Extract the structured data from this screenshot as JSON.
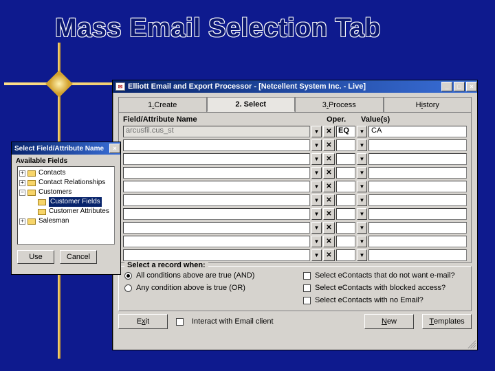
{
  "slide": {
    "title": "Mass Email Selection Tab"
  },
  "app": {
    "title": "Elliott Email and Export Processor - [Netcellent System Inc. - Live]",
    "win_buttons": {
      "min": "_",
      "max": "□",
      "close": "×"
    },
    "tabs": [
      {
        "label_pre": "1",
        "label_u": ".",
        "label_post": " Create"
      },
      {
        "label_pre": "",
        "label_u": "",
        "label_post": "2. Select",
        "active": true
      },
      {
        "label_pre": "3",
        "label_u": ".",
        "label_post": " Process"
      },
      {
        "label_pre": "H",
        "label_u": "i",
        "label_post": "story"
      }
    ],
    "headers": {
      "name": "Field/Attribute Name",
      "oper": "Oper.",
      "values": "Value(s)"
    },
    "rows": [
      {
        "field": "arcusfil.cus_st",
        "oper": "EQ",
        "value": "CA"
      },
      {
        "field": "",
        "oper": "",
        "value": ""
      },
      {
        "field": "",
        "oper": "",
        "value": ""
      },
      {
        "field": "",
        "oper": "",
        "value": ""
      },
      {
        "field": "",
        "oper": "",
        "value": ""
      },
      {
        "field": "",
        "oper": "",
        "value": ""
      },
      {
        "field": "",
        "oper": "",
        "value": ""
      },
      {
        "field": "",
        "oper": "",
        "value": ""
      },
      {
        "field": "",
        "oper": "",
        "value": ""
      },
      {
        "field": "",
        "oper": "",
        "value": ""
      }
    ],
    "select_when": {
      "legend": "Select a record when:",
      "and": "All conditions above are true (AND)",
      "or": "Any condition above is true (OR)",
      "checks": [
        "Select eContacts that do not want e-mail?",
        "Select eContacts with blocked access?",
        "Select eContacts with no Email?"
      ]
    },
    "buttons": {
      "exit_pre": "E",
      "exit_u": "x",
      "exit_post": "it",
      "interact": "Interact with Email client",
      "new_pre": "",
      "new_u": "N",
      "new_post": "ew",
      "tpl_pre": "",
      "tpl_u": "T",
      "tpl_post": "emplates"
    }
  },
  "picker": {
    "title": "Select Field/Attribute Name",
    "close": "×",
    "label": "Available Fields",
    "tree": [
      {
        "exp": "+",
        "indent": 0,
        "text": "Contacts",
        "sel": false
      },
      {
        "exp": "+",
        "indent": 0,
        "text": "Contact Relationships",
        "sel": false
      },
      {
        "exp": "−",
        "indent": 0,
        "text": "Customers",
        "sel": false
      },
      {
        "exp": "",
        "indent": 1,
        "text": "Customer Fields",
        "sel": true
      },
      {
        "exp": "",
        "indent": 1,
        "text": "Customer Attributes",
        "sel": false
      },
      {
        "exp": "+",
        "indent": 0,
        "text": "Salesman",
        "sel": false
      }
    ],
    "buttons": {
      "use": "Use",
      "cancel": "Cancel"
    }
  }
}
